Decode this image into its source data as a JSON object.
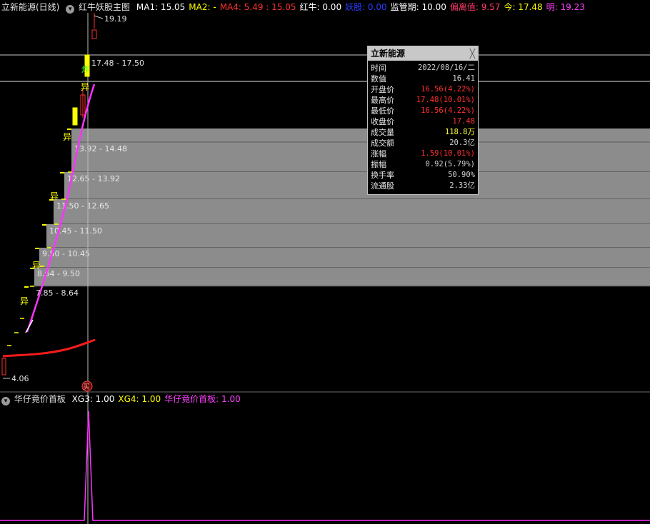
{
  "top_header": {
    "collapse_icon": "chevron-down-icon",
    "stock_title": "立新能源(日线)",
    "indicator_name": "红牛妖股主图",
    "items": [
      {
        "label": "MA1: 15.05",
        "color": "#ffffff"
      },
      {
        "label": "MA2: -",
        "color": "#ffff00"
      },
      {
        "label": "MA4: 5.49 : 15.05",
        "color": "#ff3030"
      },
      {
        "label": "红牛: 0.00",
        "color": "#ffffff"
      },
      {
        "label": "妖股: 0.00",
        "color": "#2a3cff"
      },
      {
        "label": "监管期: 10.00",
        "color": "#ffffff"
      },
      {
        "label": "偏离值: 9.57",
        "color": "#ff3a6a"
      },
      {
        "label": "今: 17.48",
        "color": "#ffff00"
      },
      {
        "label": "明: 19.23",
        "color": "#ff40ff"
      }
    ]
  },
  "chart_data": [
    {
      "type": "candlestick",
      "title": "立新能源(日线)",
      "high_marker": "19.19",
      "low_marker": "4.06",
      "crosshair_price": "17.48 - 17.50",
      "price_bands": [
        {
          "label": "13.92 - 14.48",
          "low": 13.92,
          "high": 14.48
        },
        {
          "label": "12.65 - 13.92",
          "low": 12.65,
          "high": 13.92
        },
        {
          "label": "11.50 - 12.65",
          "low": 11.5,
          "high": 12.65
        },
        {
          "label": "10.45 - 11.50",
          "low": 10.45,
          "high": 11.5
        },
        {
          "label": "9.50 - 10.45",
          "low": 9.5,
          "high": 10.45
        },
        {
          "label": "8.64 - 9.50",
          "low": 8.64,
          "high": 9.5
        },
        {
          "label": "7.85 - 8.64",
          "low": 7.85,
          "high": 8.64
        }
      ],
      "marker_text": "异",
      "boom_text": "炸",
      "bottom_marker_text": "买"
    },
    {
      "type": "line",
      "title": "华仔竟价首板",
      "series": [
        {
          "name": "XG3: 1.00",
          "color": "#ffffff"
        },
        {
          "name": "XG4: 1.00",
          "color": "#ffff00"
        },
        {
          "name": "华仔竟价首板: 1.00",
          "color": "#ff40ff"
        }
      ]
    }
  ],
  "tooltip": {
    "title": "立新能源",
    "close_icon": "close-icon",
    "rows": [
      {
        "k": "时间",
        "v": "2022/08/16/二",
        "c": "#d0d0d0"
      },
      {
        "k": "数值",
        "v": "16.41",
        "c": "#d0d0d0"
      },
      {
        "k": "开盘价",
        "v": "16.56(4.22%)",
        "c": "#ff3030"
      },
      {
        "k": "最高价",
        "v": "17.48(10.01%)",
        "c": "#ff3030"
      },
      {
        "k": "最低价",
        "v": "16.56(4.22%)",
        "c": "#ff3030"
      },
      {
        "k": "收盘价",
        "v": "17.48",
        "c": "#ff3030"
      },
      {
        "k": "成交量",
        "v": "118.8万",
        "c": "#ffff40"
      },
      {
        "k": "成交额",
        "v": "20.3亿",
        "c": "#d0d0d0"
      },
      {
        "k": "涨幅",
        "v": "1.59(10.01%)",
        "c": "#ff3030"
      },
      {
        "k": "振幅",
        "v": "0.92(5.79%)",
        "c": "#d0d0d0"
      },
      {
        "k": "换手率",
        "v": "50.90%",
        "c": "#d0d0d0"
      },
      {
        "k": "流通股",
        "v": "2.33亿",
        "c": "#d0d0d0"
      }
    ]
  },
  "sub_header": {
    "collapse_icon": "chevron-down-icon",
    "indicator_name": "华仔竟价首板"
  }
}
